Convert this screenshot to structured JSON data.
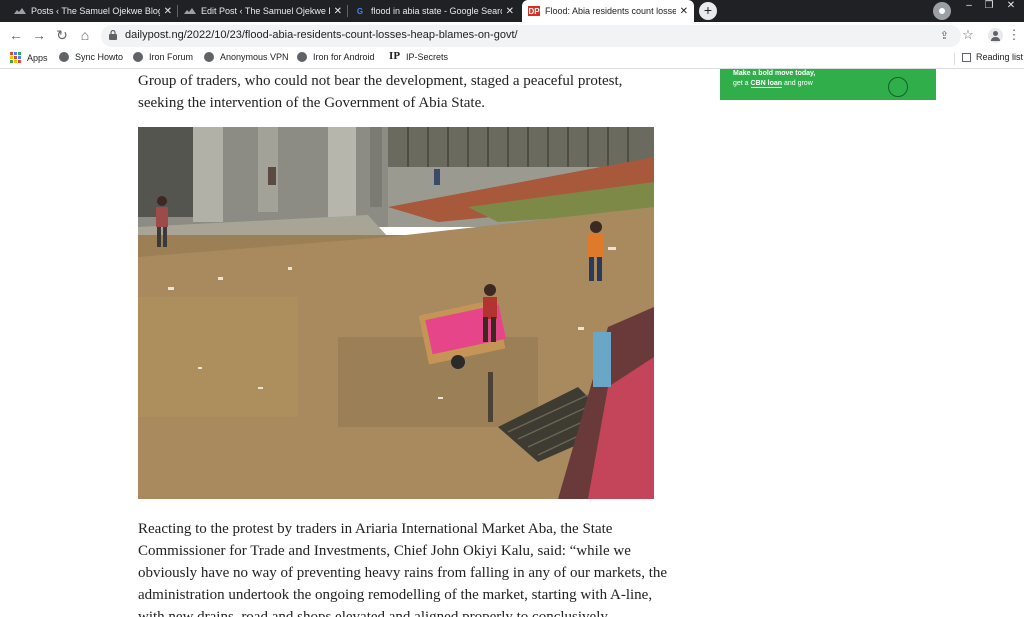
{
  "tabs": [
    {
      "title": "Posts ‹ The Samuel Ojekwe Blog — WordPress",
      "favicon": "wordpress-icon",
      "active": false
    },
    {
      "title": "Edit Post ‹ The Samuel Ojekwe Blog",
      "favicon": "wordpress-icon",
      "active": false
    },
    {
      "title": "flood in abia state - Google Search",
      "favicon": "google-icon",
      "active": false
    },
    {
      "title": "Flood: Abia residents count losses, heap blames on govt",
      "favicon": "dailypost-icon",
      "favicon_text": "DP",
      "active": true
    }
  ],
  "window": {
    "new_tab": "+",
    "minimize": "–",
    "maximize": "❐",
    "close": "✕"
  },
  "toolbar": {
    "url": "dailypost.ng/2022/10/23/flood-abia-residents-count-losses-heap-blames-on-govt/",
    "back": "←",
    "forward": "→",
    "reload": "↻",
    "home": "⌂",
    "star": "☆",
    "share": "⇪",
    "menu": "⋮",
    "lock": "🔒"
  },
  "bookmarks": [
    {
      "label": "Apps",
      "icon": "apps-grid-icon"
    },
    {
      "label": "Sync Howto",
      "icon": "globe-icon"
    },
    {
      "label": "Iron Forum",
      "icon": "globe-icon"
    },
    {
      "label": "Anonymous VPN",
      "icon": "globe-icon"
    },
    {
      "label": "Iron for Android",
      "icon": "globe-icon"
    },
    {
      "label": "IP-Secrets",
      "icon": "ip-icon",
      "icon_text": "IP"
    }
  ],
  "reading_list": "Reading list",
  "article": {
    "para1": "Group of traders, who could not bear the development, staged a peaceful protest, seeking the intervention of the Government of Abia State.",
    "para2": "Reacting to the protest by traders in Ariaria International Market Aba, the State Commissioner for Trade and Investments, Chief John Okiyi Kalu, said: “while we obviously have no way of preventing heavy rains from falling in any of our markets, the administration undertook the ongoing remodelling of the market, starting with A-line, with new drains, road and shops elevated and aligned properly to conclusively"
  },
  "ad": {
    "line1": "Make a bold move today,",
    "line2_prefix": "get a ",
    "line2_link": "CBN loan",
    "line2_suffix": " and grow",
    "color": "#2fae4a"
  },
  "colors": {
    "tab_strip": "#202124",
    "omnibox": "#f1f3f4"
  }
}
